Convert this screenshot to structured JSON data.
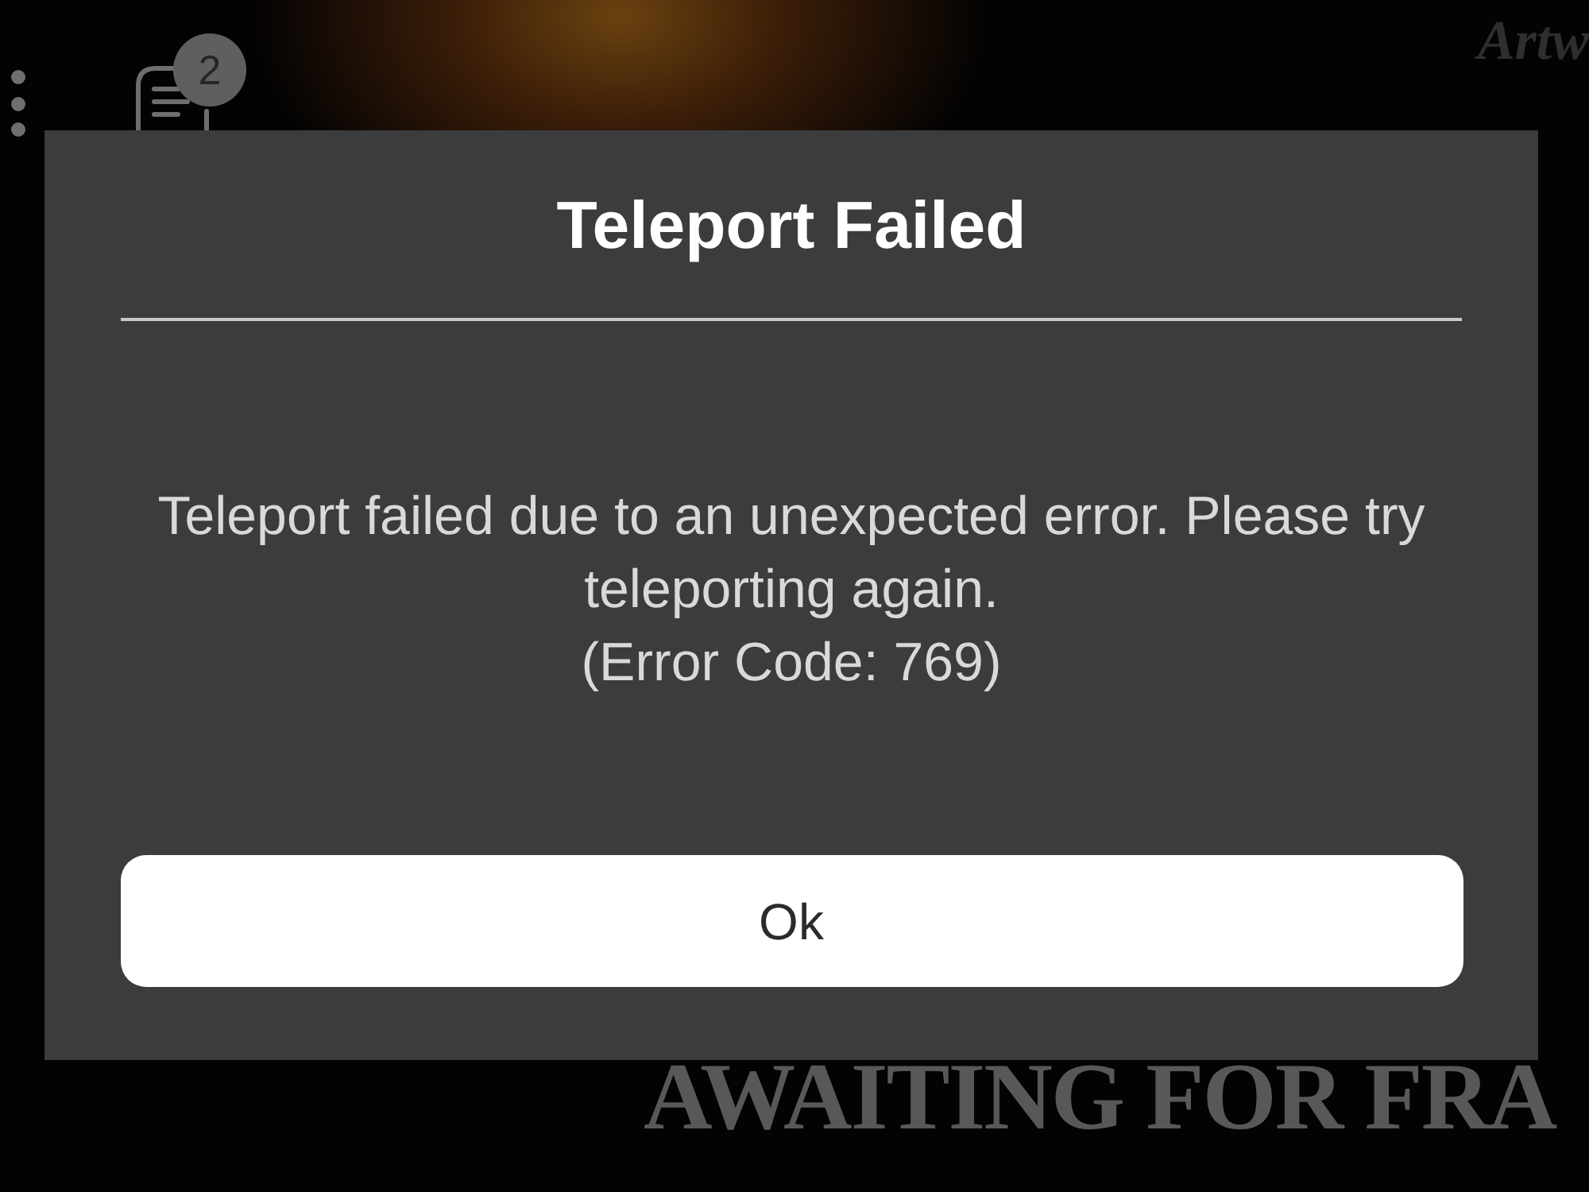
{
  "top_bar": {
    "chat_badge": "2"
  },
  "background": {
    "corner_text": "Artw",
    "banner_text": "AWAITING FOR FRA"
  },
  "dialog": {
    "title": "Teleport Failed",
    "message": "Teleport failed due to an unexpected error. Please try teleporting again.",
    "error_code": "(Error Code: 769)",
    "buttons": [
      "Ok"
    ]
  }
}
